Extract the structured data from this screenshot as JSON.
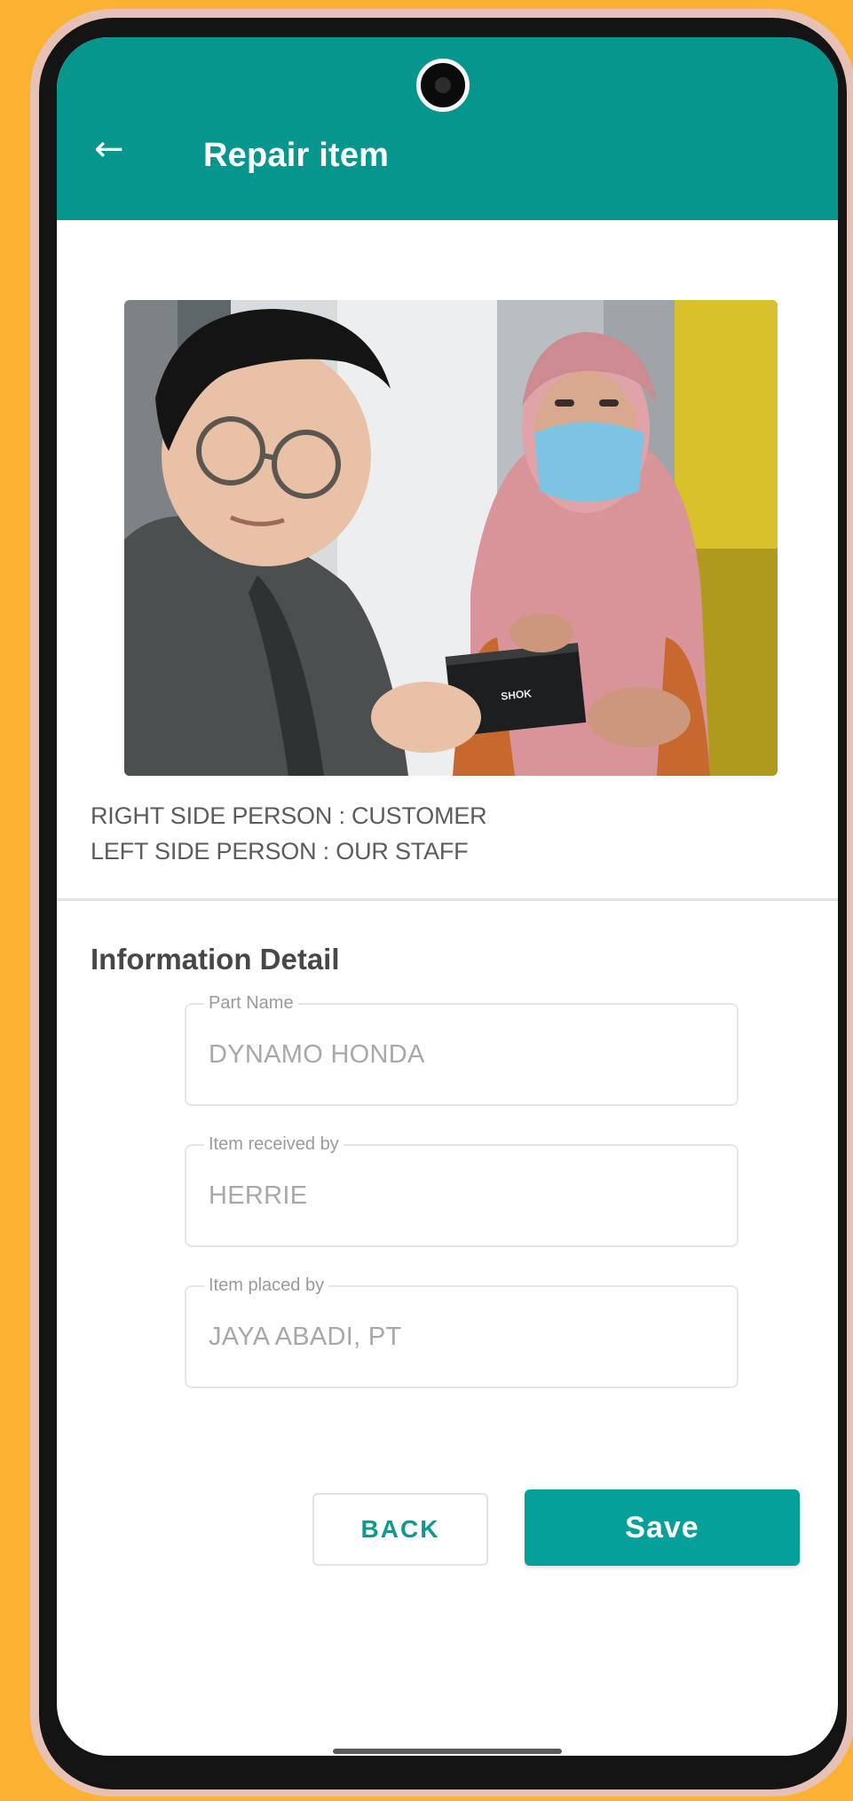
{
  "appbar": {
    "title": "Repair item",
    "back_icon": "arrow-left-icon",
    "color": "#06968e"
  },
  "photo": {
    "box_label": "SHOK"
  },
  "captions": {
    "line1": "RIGHT SIDE PERSON : CUSTOMER",
    "line2": "LEFT SIDE PERSON : OUR STAFF"
  },
  "section": {
    "title": "Information Detail"
  },
  "fields": [
    {
      "label": "Part Name",
      "value": "DYNAMO HONDA"
    },
    {
      "label": "Item received by",
      "value": "HERRIE"
    },
    {
      "label": "Item placed by",
      "value": "JAYA ABADI, PT"
    }
  ],
  "buttons": {
    "back": "BACK",
    "save": "Save"
  },
  "colors": {
    "background": "#fbb233",
    "accent": "#06a09a"
  }
}
